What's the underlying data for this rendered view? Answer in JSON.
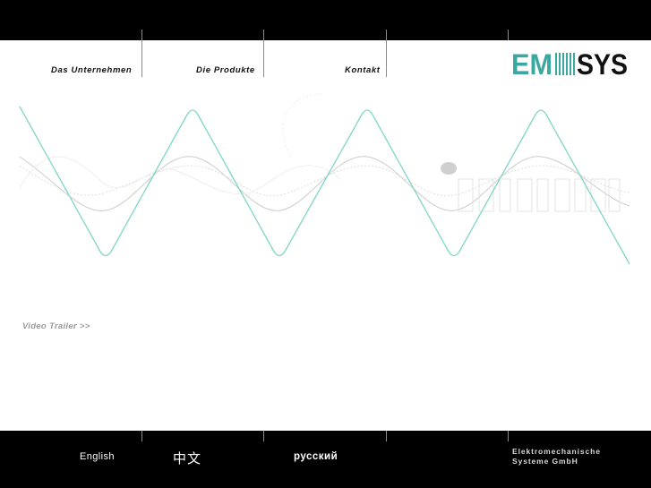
{
  "nav": {
    "items": [
      {
        "label": "Das Unternehmen"
      },
      {
        "label": "Die Produkte"
      },
      {
        "label": "Kontakt"
      }
    ]
  },
  "logo": {
    "part1": "EM",
    "part2": "SYS",
    "color_primary": "#3aa8a0",
    "color_secondary": "#111111"
  },
  "colors": {
    "wave_primary": "#7fd6c8",
    "wave_secondary": "#cccccc",
    "bars": "#000000"
  },
  "main": {
    "trailer_link": "Video Trailer >>"
  },
  "footer": {
    "languages": [
      {
        "label": "English"
      },
      {
        "label": "中文"
      },
      {
        "label": "русский"
      }
    ],
    "company_line1": "Elektromechanische",
    "company_line2": "Systeme GmbH"
  }
}
